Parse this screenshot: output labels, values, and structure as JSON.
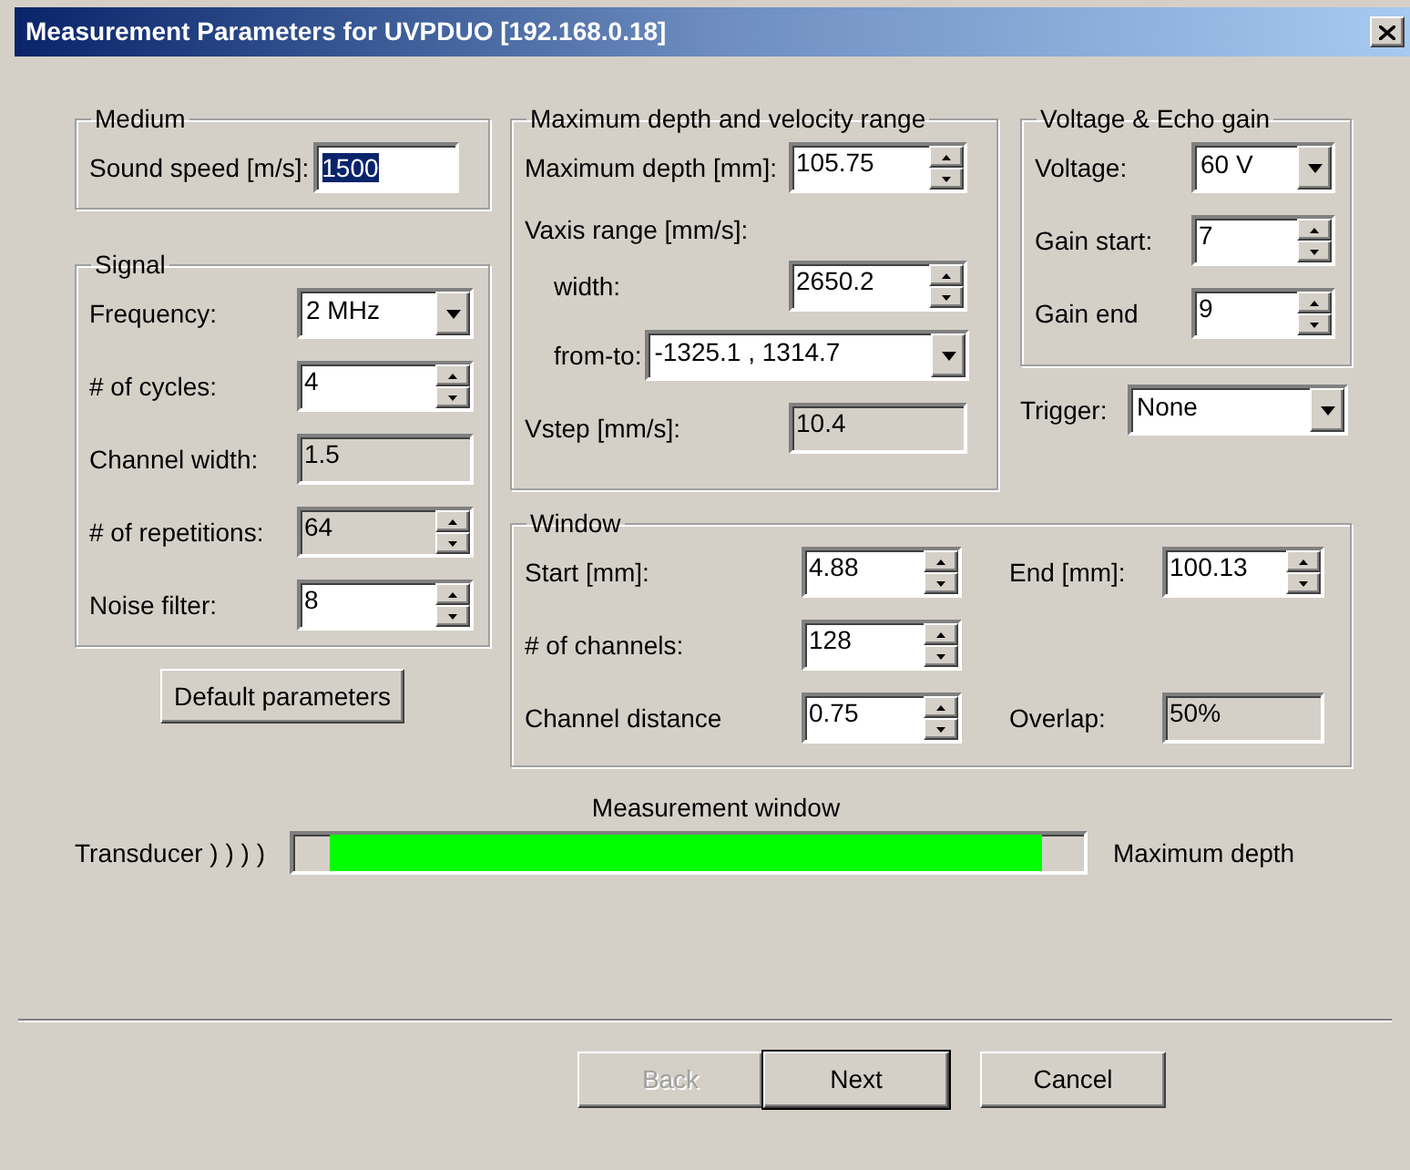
{
  "window": {
    "title": "Measurement Parameters for UVPDUO [192.168.0.18]"
  },
  "medium": {
    "title": "Medium",
    "fields": [
      {
        "label": "Sound speed [m/s]:",
        "kind": "text",
        "value": "1500",
        "highlighted": true,
        "disabled": false
      }
    ]
  },
  "signal": {
    "title": "Signal",
    "fields": [
      {
        "label": "Frequency:",
        "kind": "dropdown",
        "value": "2 MHz",
        "disabled": false
      },
      {
        "label": "# of cycles:",
        "kind": "spin",
        "value": "4",
        "disabled": false
      },
      {
        "label": "Channel width:",
        "kind": "readonly",
        "value": "1.5",
        "disabled": true
      },
      {
        "label": "# of repetitions:",
        "kind": "spin",
        "value": "64",
        "disabled": true
      },
      {
        "label": "Noise filter:",
        "kind": "spin",
        "value": "8",
        "disabled": false
      }
    ]
  },
  "default_button": {
    "label": "Default parameters"
  },
  "range": {
    "title": "Maximum depth and velocity range",
    "fields": [
      {
        "label": "Maximum depth [mm]:",
        "kind": "spin",
        "value": "105.75",
        "disabled": false
      },
      {
        "label": "Vaxis range [mm/s]:",
        "kind": "heading"
      },
      {
        "label": "width:",
        "kind": "spin",
        "value": "2650.2",
        "disabled": false
      },
      {
        "label": "from-to:",
        "kind": "dropdown",
        "value": "-1325.1 , 1314.7",
        "disabled": false
      },
      {
        "label": "Vstep [mm/s]:",
        "kind": "readonly",
        "value": "10.4",
        "disabled": true
      }
    ]
  },
  "voltage": {
    "title": "Voltage & Echo gain",
    "fields": [
      {
        "label": "Voltage:",
        "kind": "dropdown",
        "value": "60 V",
        "disabled": false
      },
      {
        "label": "Gain start:",
        "kind": "spin",
        "value": "7",
        "disabled": false
      },
      {
        "label": "Gain end",
        "kind": "spin",
        "value": "9",
        "disabled": false
      }
    ]
  },
  "trigger": {
    "label": "Trigger:",
    "kind": "dropdown",
    "value": "None",
    "disabled": false
  },
  "window_group": {
    "title": "Window",
    "fields": [
      {
        "label": "Start [mm]:",
        "kind": "spin",
        "value": "4.88",
        "disabled": false
      },
      {
        "label": "End [mm]:",
        "kind": "spin",
        "value": "100.13",
        "disabled": false
      },
      {
        "label": "# of channels:",
        "kind": "spin",
        "value": "128",
        "disabled": false
      },
      {
        "label": "Channel distance",
        "kind": "spin",
        "value": "0.75",
        "disabled": false
      },
      {
        "label": "Overlap:",
        "kind": "readonly",
        "value": "50%",
        "disabled": true
      }
    ]
  },
  "measurement_window": {
    "title": "Measurement window",
    "left_label": "Transducer ) ) ) )",
    "right_label": "Maximum depth"
  },
  "buttons": [
    {
      "label": "Back",
      "disabled": true,
      "default": false
    },
    {
      "label": "Next",
      "disabled": false,
      "default": true
    },
    {
      "label": "Cancel",
      "disabled": false,
      "default": false
    }
  ]
}
